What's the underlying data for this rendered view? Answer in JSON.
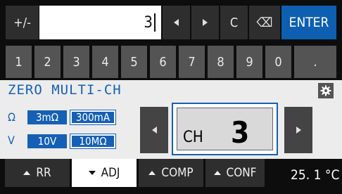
{
  "keypad": {
    "sign_label": "+/-",
    "entry_value": "3",
    "clear_label": "C",
    "backspace_glyph": "⌫",
    "enter_label": "ENTER",
    "digits": [
      "1",
      "2",
      "3",
      "4",
      "5",
      "6",
      "7",
      "8",
      "9",
      "0",
      "."
    ]
  },
  "panel": {
    "title": "ZERO MULTI-CH",
    "omega_label": "Ω",
    "v_label": "V",
    "omega_opts": [
      "3mΩ",
      "300mA"
    ],
    "v_opts": [
      "10V",
      "10MΩ"
    ],
    "channel_prefix": "CH",
    "channel_value": "3"
  },
  "tabs": [
    {
      "label": "RR",
      "arrow": "up"
    },
    {
      "label": "ADJ",
      "arrow": "down"
    },
    {
      "label": "COMP",
      "arrow": "up"
    },
    {
      "label": "CONF",
      "arrow": "up"
    }
  ],
  "status": {
    "temperature": "25. 1 °C"
  },
  "colors": {
    "accent": "#1560b5",
    "enter": "#0e5fb1",
    "panel": "#ececec",
    "key_dark": "#2e2e2e",
    "key_grey": "#545454"
  }
}
